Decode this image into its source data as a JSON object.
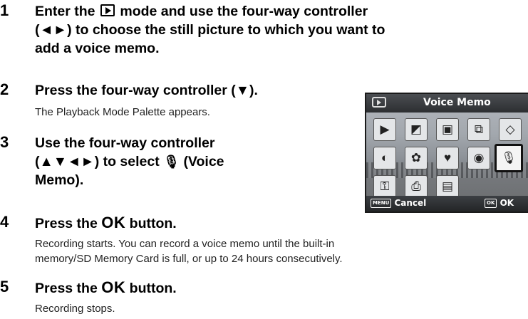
{
  "steps": [
    {
      "num": "1",
      "head_a": "Enter the",
      "head_b": "mode and use the four-way controller",
      "head_line2": "(◄►) to choose the still picture to which you want to",
      "head_line3": "add a voice memo."
    },
    {
      "num": "2",
      "head": "Press the four-way controller (▼).",
      "sub": "The Playback Mode Palette appears."
    },
    {
      "num": "3",
      "head_line1": "Use the four-way controller",
      "head_line2": "(▲▼◄►) to select",
      "head_line2b": "(Voice",
      "head_line3": "Memo)."
    },
    {
      "num": "4",
      "head_a": "Press the",
      "ok": "OK",
      "head_b": "button.",
      "sub1": "Recording starts. You can record a voice memo until the built-in",
      "sub2": "memory/SD Memory Card is full, or up to 24 hours consecutively."
    },
    {
      "num": "5",
      "head_a": "Press the",
      "ok": "OK",
      "head_b": "button.",
      "sub": "Recording stops."
    }
  ],
  "screen": {
    "title": "Voice Memo",
    "footer_left_tag": "MENU",
    "footer_left": "Cancel",
    "footer_right_tag": "OK",
    "footer_right": "OK"
  },
  "palette_icons": [
    "playback-icon",
    "resize-icon",
    "crop-icon",
    "copy-image-icon",
    "rotate-icon",
    "filter-icon",
    "digital-filter-icon",
    "frame-icon",
    "red-eye-icon",
    "voice-memo-icon",
    "protect-icon",
    "dpof-icon",
    "start-screen-icon"
  ]
}
